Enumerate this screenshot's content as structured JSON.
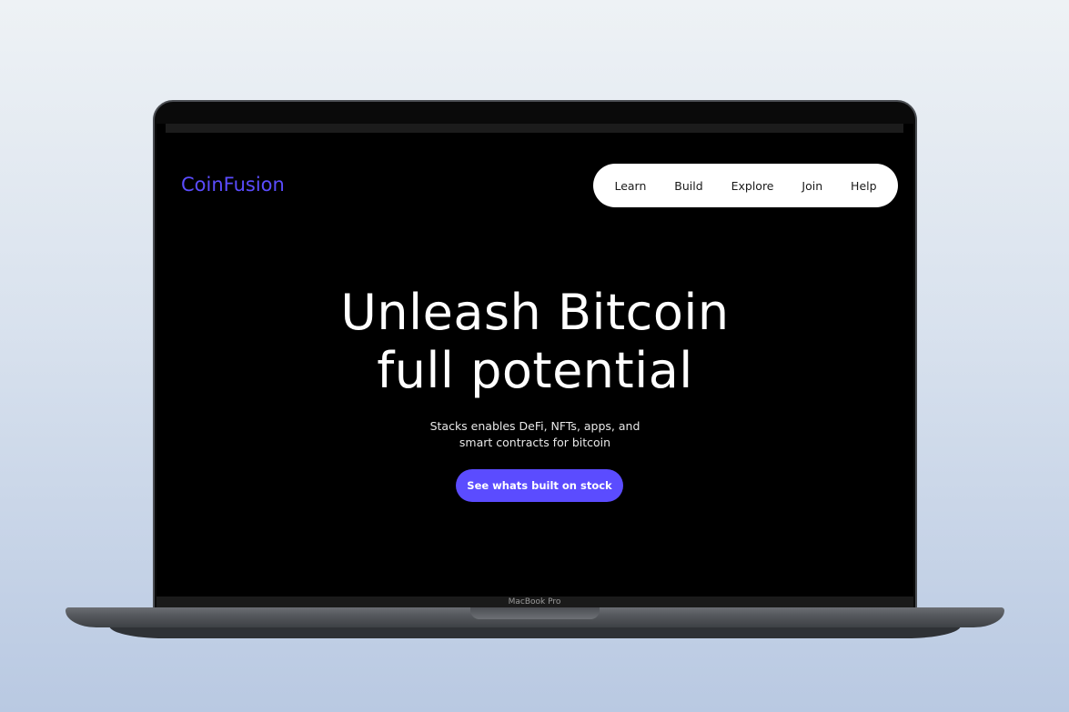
{
  "brand": "CoinFusion",
  "nav": [
    "Learn",
    "Build",
    "Explore",
    "Join",
    "Help"
  ],
  "hero": {
    "title_line1": "Unleash Bitcoin",
    "title_line2": "full potential",
    "subtitle_line1": "Stacks enables DeFi, NFTs, apps, and",
    "subtitle_line2": "smart contracts for bitcoin",
    "cta": "See whats built on stock"
  },
  "device_label": "MacBook Pro",
  "colors": {
    "accent": "#5b4cff",
    "background": "#000000"
  }
}
